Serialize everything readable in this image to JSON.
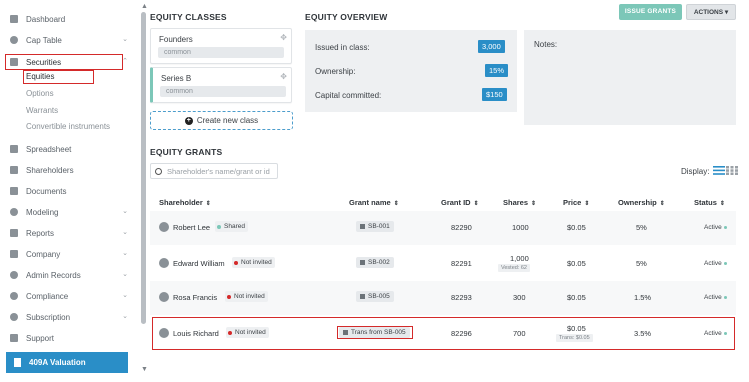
{
  "sidebar": {
    "items": [
      {
        "label": "Dashboard",
        "icon": "dashboard-icon"
      },
      {
        "label": "Cap Table",
        "icon": "pie-chart-icon"
      },
      {
        "label": "Securities",
        "icon": "clipboard-icon"
      },
      {
        "label": "Spreadsheet",
        "icon": "grid-icon"
      },
      {
        "label": "Shareholders",
        "icon": "person-icon"
      },
      {
        "label": "Documents",
        "icon": "folder-icon"
      },
      {
        "label": "Modeling",
        "icon": "bulb-icon"
      },
      {
        "label": "Reports",
        "icon": "reports-icon"
      },
      {
        "label": "Company",
        "icon": "building-icon"
      },
      {
        "label": "Admin Records",
        "icon": "admin-icon"
      },
      {
        "label": "Compliance",
        "icon": "compliance-icon"
      },
      {
        "label": "Subscription",
        "icon": "subscription-icon"
      },
      {
        "label": "Support",
        "icon": "support-icon"
      }
    ],
    "securities_sub": [
      "Equities",
      "Options",
      "Warrants",
      "Convertible instruments"
    ],
    "valuation_button": "409A Valuation"
  },
  "equity_classes": {
    "title": "EQUITY CLASSES",
    "classes": [
      {
        "name": "Founders",
        "type": "common"
      },
      {
        "name": "Series B",
        "type": "common"
      }
    ],
    "create_label": "Create new class"
  },
  "overview": {
    "title": "EQUITY OVERVIEW",
    "rows": [
      {
        "label": "Issued in class:",
        "value": "3,000"
      },
      {
        "label": "Ownership:",
        "value": "15%"
      },
      {
        "label": "Capital committed:",
        "value": "$150"
      }
    ],
    "notes_label": "Notes:"
  },
  "actions": {
    "issue_grants": "ISSUE GRANTS",
    "actions": "ACTIONS"
  },
  "grants": {
    "title": "EQUITY GRANTS",
    "search_placeholder": "Shareholder's name/grant or id",
    "display_label": "Display:",
    "columns": [
      "Shareholder",
      "Grant name",
      "Grant ID",
      "Shares",
      "Price",
      "Ownership",
      "Status"
    ],
    "rows": [
      {
        "shareholder": "Robert Lee",
        "invite": "Shared",
        "invite_color": "#7cc7b8",
        "grant_name": "SB-001",
        "grant_id": "82290",
        "shares": "1000",
        "shares_note": "",
        "price": "$0.05",
        "price_note": "",
        "ownership": "5%",
        "status": "Active"
      },
      {
        "shareholder": "Edward William",
        "invite": "Not invited",
        "invite_color": "#d42a2a",
        "grant_name": "SB-002",
        "grant_id": "82291",
        "shares": "1,000",
        "shares_note": "Vested: 62",
        "price": "$0.05",
        "price_note": "",
        "ownership": "5%",
        "status": "Active"
      },
      {
        "shareholder": "Rosa Francis",
        "invite": "Not invited",
        "invite_color": "#d42a2a",
        "grant_name": "SB-005",
        "grant_id": "82293",
        "shares": "300",
        "shares_note": "",
        "price": "$0.05",
        "price_note": "",
        "ownership": "1.5%",
        "status": "Active"
      },
      {
        "shareholder": "Louis Richard",
        "invite": "Not invited",
        "invite_color": "#d42a2a",
        "grant_name": "Trans from SB-005",
        "grant_id": "82296",
        "shares": "700",
        "shares_note": "",
        "price": "$0.05",
        "price_note": "Trans: $0.05",
        "ownership": "3.5%",
        "status": "Active"
      }
    ]
  },
  "colors": {
    "accent_blue": "#2a8ec7",
    "accent_teal": "#7cc7b8",
    "highlight_red": "#d42a2a"
  }
}
